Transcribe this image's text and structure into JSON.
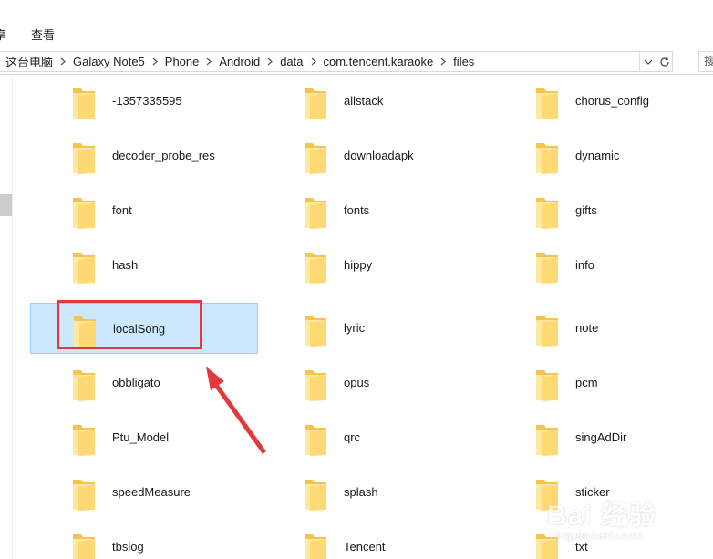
{
  "ribbon": {
    "tabs": [
      {
        "label": "享"
      },
      {
        "label": "查看"
      }
    ]
  },
  "address_bar": {
    "crumbs": [
      "这台电脑",
      "Galaxy Note5",
      "Phone",
      "Android",
      "data",
      "com.tencent.karaoke",
      "files"
    ],
    "search_placeholder": "搜"
  },
  "files": {
    "items": [
      {
        "label": "-1357335595"
      },
      {
        "label": "allstack"
      },
      {
        "label": "chorus_config"
      },
      {
        "label": "decoder_probe_res"
      },
      {
        "label": "downloadapk"
      },
      {
        "label": "dynamic"
      },
      {
        "label": "font"
      },
      {
        "label": "fonts"
      },
      {
        "label": "gifts"
      },
      {
        "label": "hash"
      },
      {
        "label": "hippy"
      },
      {
        "label": "info"
      },
      {
        "label": "localSong"
      },
      {
        "label": "lyric"
      },
      {
        "label": "note"
      },
      {
        "label": "obbligato"
      },
      {
        "label": "opus"
      },
      {
        "label": "pcm"
      },
      {
        "label": "Ptu_Model"
      },
      {
        "label": "qrc"
      },
      {
        "label": "singAdDir"
      },
      {
        "label": "speedMeasure"
      },
      {
        "label": "splash"
      },
      {
        "label": "sticker"
      },
      {
        "label": "tbslog"
      },
      {
        "label": "Tencent"
      },
      {
        "label": "txt"
      }
    ],
    "selected": "localSong"
  },
  "watermark": {
    "brand": "Bai 经验",
    "url": "jingyan.baidu.com"
  },
  "colors": {
    "selection_bg": "#cce8ff",
    "selection_border": "#99d1ff",
    "annotation_red": "#e4393c",
    "folder_light": "#ffe8a0",
    "folder_dark": "#f4c44e"
  }
}
